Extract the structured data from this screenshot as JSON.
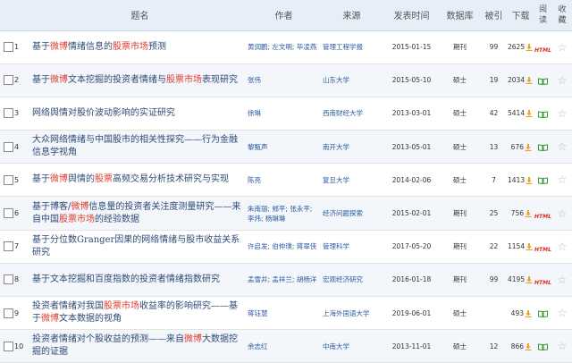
{
  "header": {
    "title": "题名",
    "author": "作者",
    "source": "来源",
    "date": "发表时间",
    "database": "数据库",
    "cited": "被引",
    "download": "下载",
    "read": "阅读",
    "favorite": "收藏"
  },
  "icons": {
    "download": "download-arrow-icon",
    "read_book": "open-book-icon",
    "read_html": "HTML",
    "favorite": "star-icon"
  },
  "colors": {
    "highlight": "#e03b30",
    "link": "#2a5a9f",
    "header_bg": "#e6eef7",
    "download_icon": "#f0a020",
    "book_icon": "#3a9d3a"
  },
  "rows": [
    {
      "num": "1",
      "title": [
        {
          "t": "基于"
        },
        {
          "t": "微博",
          "hl": true
        },
        {
          "t": "情绪信息的"
        },
        {
          "t": "股票市场",
          "hl": true
        },
        {
          "t": "预测"
        }
      ],
      "author": "黄润鹏; 左文明; 毕凌燕",
      "source": "管理工程学报",
      "date": "2015-01-15",
      "database": "期刊",
      "cited": "99",
      "downloads": "2625",
      "read": "html"
    },
    {
      "num": "2",
      "title": [
        {
          "t": "基于"
        },
        {
          "t": "微博",
          "hl": true
        },
        {
          "t": "文本挖掘的投资者情绪与"
        },
        {
          "t": "股票市场",
          "hl": true
        },
        {
          "t": "表现研究"
        }
      ],
      "author": "张伟",
      "source": "山东大学",
      "date": "2015-05-10",
      "database": "硕士",
      "cited": "19",
      "downloads": "2034",
      "read": "book"
    },
    {
      "num": "3",
      "title": [
        {
          "t": "网络舆情对股价波动影响的实证研究"
        }
      ],
      "author": "徐琳",
      "source": "西南财经大学",
      "date": "2013-03-01",
      "database": "硕士",
      "cited": "42",
      "downloads": "5414",
      "read": "book"
    },
    {
      "num": "4",
      "title": [
        {
          "t": "大众网络情绪与中国股市的相关性探究——行为金融信息学视角"
        }
      ],
      "author": "黎甄声",
      "source": "南开大学",
      "date": "2013-05-01",
      "database": "硕士",
      "cited": "13",
      "downloads": "676",
      "read": "book"
    },
    {
      "num": "5",
      "title": [
        {
          "t": "基于"
        },
        {
          "t": "微博",
          "hl": true
        },
        {
          "t": "舆情的"
        },
        {
          "t": "股票",
          "hl": true
        },
        {
          "t": "高频交易分析技术研究与实现"
        }
      ],
      "author": "陈亮",
      "source": "复旦大学",
      "date": "2014-02-06",
      "database": "硕士",
      "cited": "7",
      "downloads": "1413",
      "read": "book"
    },
    {
      "num": "6",
      "title": [
        {
          "t": "基于博客/"
        },
        {
          "t": "微博",
          "hl": true
        },
        {
          "t": "信息量的投资者关注度测量研究——来自中国"
        },
        {
          "t": "股票市场",
          "hl": true
        },
        {
          "t": "的经验数据"
        }
      ],
      "author": "朱南丽; 郏平; 张永平; 李炜; 杨琳琳",
      "source": "经济问题探索",
      "date": "2015-02-01",
      "database": "期刊",
      "cited": "25",
      "downloads": "756",
      "read": "html"
    },
    {
      "num": "7",
      "title": [
        {
          "t": "基于分位数Granger因果的网络情绪与股市收益关系研究"
        }
      ],
      "author": "许启发; 伯仲璞; 蒋翠侠",
      "source": "管理科学",
      "date": "2017-05-20",
      "database": "期刊",
      "cited": "22",
      "downloads": "1154",
      "read": "html"
    },
    {
      "num": "8",
      "title": [
        {
          "t": "基于文本挖掘和百度指数的投资者情绪指数研究"
        }
      ],
      "author": "孟雪井; 孟祥兰; 胡杨洋",
      "source": "宏观经济研究",
      "date": "2016-01-18",
      "database": "期刊",
      "cited": "99",
      "downloads": "4195",
      "read": "html"
    },
    {
      "num": "9",
      "title": [
        {
          "t": "投资者情绪对我国"
        },
        {
          "t": "股票市场",
          "hl": true
        },
        {
          "t": "收益率的影响研究——基于"
        },
        {
          "t": "微博",
          "hl": true
        },
        {
          "t": "文本数据的视角"
        }
      ],
      "author": "蒋钰慧",
      "source": "上海外国语大学",
      "date": "2019-06-01",
      "database": "硕士",
      "cited": "",
      "downloads": "493",
      "read": "book"
    },
    {
      "num": "10",
      "title": [
        {
          "t": "投资者情绪对个股收益的预测——来自"
        },
        {
          "t": "微博",
          "hl": true
        },
        {
          "t": "大数据挖掘的证据"
        }
      ],
      "author": "余志红",
      "source": "中南大学",
      "date": "2013-11-01",
      "database": "硕士",
      "cited": "12",
      "downloads": "866",
      "read": "book"
    }
  ]
}
